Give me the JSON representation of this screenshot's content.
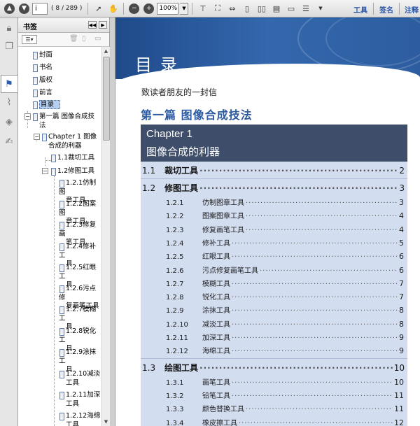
{
  "toolbar": {
    "current_page": "i",
    "page_count": "( 8 / 289 )",
    "zoom": "100%",
    "menu_tools": "工具",
    "menu_sign": "签名",
    "menu_comment": "注释"
  },
  "bookmarks_panel": {
    "title": "书签",
    "items": [
      {
        "label": "封面"
      },
      {
        "label": "书名"
      },
      {
        "label": "版权"
      },
      {
        "label": "前言"
      },
      {
        "label": "目录"
      },
      {
        "label": "第一篇  图像合成技",
        "label2": "法"
      },
      {
        "label": "Chapter 1  图像",
        "label2": "合成的利器"
      },
      {
        "label": "1.1裁切工具"
      },
      {
        "label": "1.2修图工具"
      },
      {
        "label": "1.2.1仿制图",
        "label2": "章工具"
      },
      {
        "label": "1.2.2图案图",
        "label2": "章工具"
      },
      {
        "label": "1.2.3修复画",
        "label2": "笔工具"
      },
      {
        "label": "1.2.4修补工",
        "label2": "具"
      },
      {
        "label": "1.2.5红眼工",
        "label2": "具"
      },
      {
        "label": "1.2.6污点修",
        "label2": "复画笔工具"
      },
      {
        "label": "1.2.7模糊工",
        "label2": "具"
      },
      {
        "label": "1.2.8锐化工",
        "label2": "具"
      },
      {
        "label": "1.2.9涂抹工",
        "label2": "具"
      },
      {
        "label": "1.2.10减淡",
        "label2": "工具"
      },
      {
        "label": "1.2.11加深",
        "label2": "工具"
      },
      {
        "label": "1.2.12海绵",
        "label2": "工具"
      }
    ]
  },
  "document": {
    "banner_title": "目录",
    "letter": "致读者朋友的一封信",
    "part": "第一篇  图像合成技法",
    "chapter_en": "Chapter 1",
    "chapter_cn": "图像合成的利器",
    "toc": [
      {
        "num": "1.1",
        "title": "裁切工具",
        "page": "2",
        "level": 1
      },
      {
        "num": "1.2",
        "title": "修图工具",
        "page": "3",
        "level": 1
      },
      {
        "num": "1.2.1",
        "title": "仿制图章工具",
        "page": "3",
        "level": 2
      },
      {
        "num": "1.2.2",
        "title": "图案图章工具",
        "page": "4",
        "level": 2
      },
      {
        "num": "1.2.3",
        "title": "修复画笔工具",
        "page": "4",
        "level": 2
      },
      {
        "num": "1.2.4",
        "title": "修补工具",
        "page": "5",
        "level": 2
      },
      {
        "num": "1.2.5",
        "title": "红眼工具",
        "page": "6",
        "level": 2
      },
      {
        "num": "1.2.6",
        "title": "污点修复画笔工具",
        "page": "6",
        "level": 2
      },
      {
        "num": "1.2.7",
        "title": "模糊工具",
        "page": "7",
        "level": 2
      },
      {
        "num": "1.2.8",
        "title": "锐化工具",
        "page": "7",
        "level": 2
      },
      {
        "num": "1.2.9",
        "title": "涂抹工具",
        "page": "8",
        "level": 2
      },
      {
        "num": "1.2.10",
        "title": "减淡工具",
        "page": "8",
        "level": 2
      },
      {
        "num": "1.2.11",
        "title": "加深工具",
        "page": "9",
        "level": 2
      },
      {
        "num": "1.2.12",
        "title": "海绵工具",
        "page": "9",
        "level": 2
      },
      {
        "num": "1.3",
        "title": "绘图工具",
        "page": "10",
        "level": 1
      },
      {
        "num": "1.3.1",
        "title": "画笔工具",
        "page": "10",
        "level": 2
      },
      {
        "num": "1.3.2",
        "title": "铅笔工具",
        "page": "11",
        "level": 2
      },
      {
        "num": "1.3.3",
        "title": "颜色替换工具",
        "page": "11",
        "level": 2
      },
      {
        "num": "1.3.4",
        "title": "橡皮擦工具",
        "page": "12",
        "level": 2
      }
    ]
  }
}
